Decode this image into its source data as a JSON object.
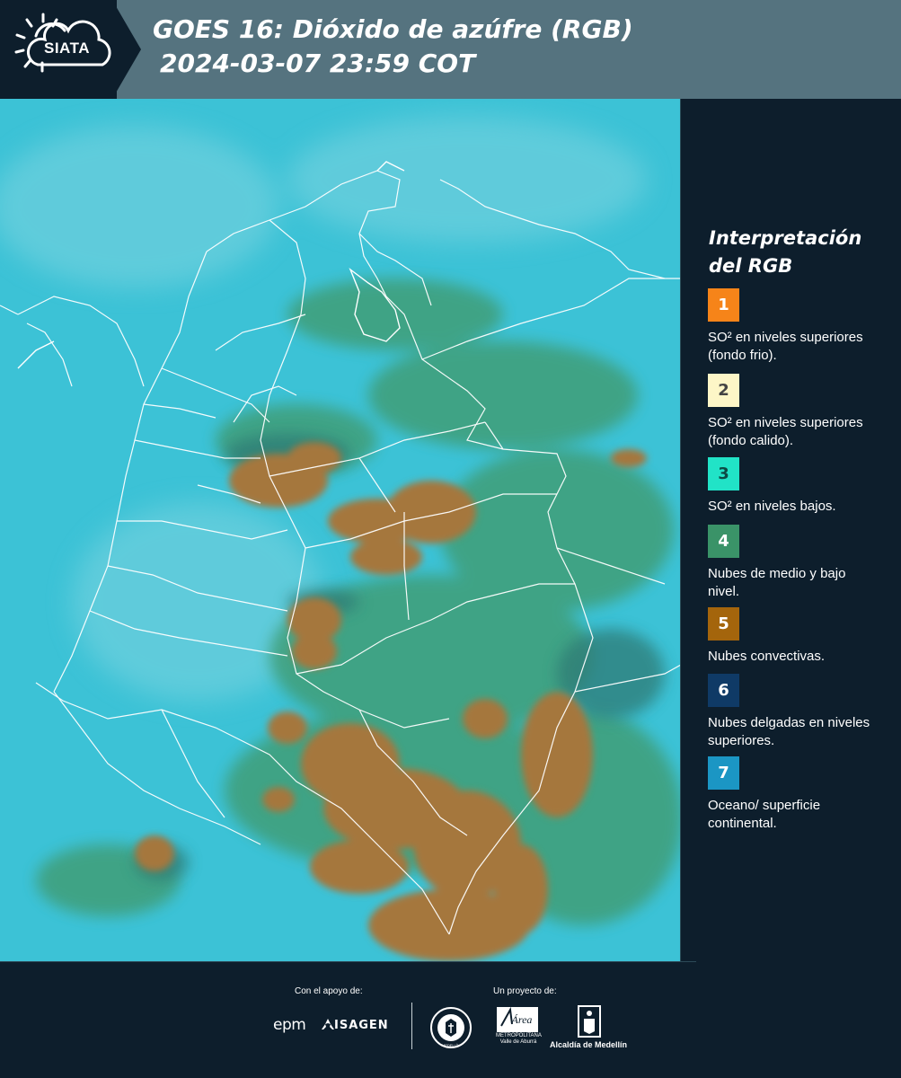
{
  "header": {
    "logo_text": "SIATA",
    "title_line1": "GOES 16: Dióxido de azúfre (RGB)",
    "title_line2": "2024-03-07 23:59 COT"
  },
  "map": {
    "layer": "GOES 16 Sulfur Dioxide RGB",
    "base_color": "#3cc2d6",
    "convective_color": "#a5773c"
  },
  "legend": {
    "title_line1": "Interpretación",
    "title_line2": "del RGB",
    "items": [
      {
        "number": "1",
        "color": "#f68419",
        "text_color": "#ffffff",
        "description": "SO² en niveles superiores (fondo frio)."
      },
      {
        "number": "2",
        "color": "#fdf6c7",
        "text_color": "#444444",
        "description": "SO² en niveles superiores (fondo calido)."
      },
      {
        "number": "3",
        "color": "#21e3c7",
        "text_color": "#0d4a44",
        "description": "SO² en niveles bajos."
      },
      {
        "number": "4",
        "color": "#3a9368",
        "text_color": "#ffffff",
        "description": "Nubes de medio y bajo nivel."
      },
      {
        "number": "5",
        "color": "#a4650c",
        "text_color": "#ffffff",
        "description": "Nubes convectivas."
      },
      {
        "number": "6",
        "color": "#0f3a66",
        "text_color": "#ffffff",
        "description": "Nubes delgadas en niveles superiores."
      },
      {
        "number": "7",
        "color": "#1b96c4",
        "text_color": "#ffffff",
        "description": "Oceano/ superficie continental."
      }
    ]
  },
  "footer": {
    "support_label": "Con el apoyo de:",
    "project_label": "Un proyecto de:",
    "epm_text": "epm",
    "isagen_text": "ISAGEN",
    "medellin_seal": "MEDELLÍN",
    "metro_logo_text": "Área",
    "metro_text": "METROPOLITANA Valle de Aburrá",
    "alcaldia_text": "Alcaldía de Medellín"
  }
}
